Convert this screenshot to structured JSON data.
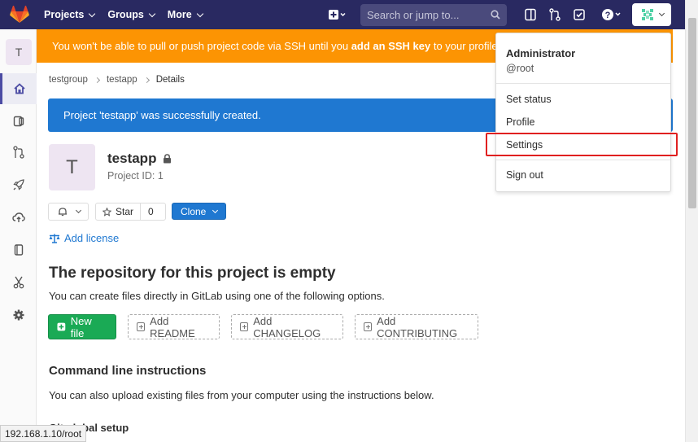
{
  "topbar": {
    "nav": [
      "Projects",
      "Groups",
      "More"
    ],
    "search_placeholder": "Search or jump to...",
    "icons": [
      "gitlab-logo",
      "plus-square-icon",
      "search-icon",
      "todo-sidebar-icon",
      "merge-request-icon",
      "issues-check-icon",
      "help-icon",
      "user-avatar-icon"
    ]
  },
  "sidebar": {
    "project_initial": "T",
    "items": [
      "home-icon",
      "issues-icon",
      "merge-requests-icon",
      "rocket-icon",
      "cloud-icon",
      "book-icon",
      "snippet-scissors-icon",
      "settings-gear-icon",
      "collapse-icon"
    ]
  },
  "banner": {
    "text_before": "You won't be able to pull or push project code via SSH until you ",
    "link": "add an SSH key",
    "text_after": " to your profile",
    "color": "#fc9403"
  },
  "breadcrumbs": [
    "testgroup",
    "testapp",
    "Details"
  ],
  "flash": {
    "text": "Project 'testapp' was successfully created.",
    "color": "#1f78d1"
  },
  "project": {
    "initial": "T",
    "name": "testapp",
    "id_label": "Project ID: 1",
    "star_label": "Star",
    "star_count": "0",
    "clone_label": "Clone",
    "add_license": "Add license"
  },
  "empty_repo": {
    "heading": "The repository for this project is empty",
    "description": "You can create files directly in GitLab using one of the following options.",
    "new_file": "New file",
    "add_readme": "Add README",
    "add_changelog": "Add CHANGELOG",
    "add_contributing": "Add CONTRIBUTING"
  },
  "cli": {
    "heading": "Command line instructions",
    "description": "You can also upload existing files from your computer using the instructions below.",
    "partial_heading": "Git global setup"
  },
  "status_bar": "192.168.1.10/root",
  "user_menu": {
    "name": "Administrator",
    "username": "@root",
    "items": [
      "Set status",
      "Profile",
      "Settings",
      "Sign out"
    ]
  }
}
